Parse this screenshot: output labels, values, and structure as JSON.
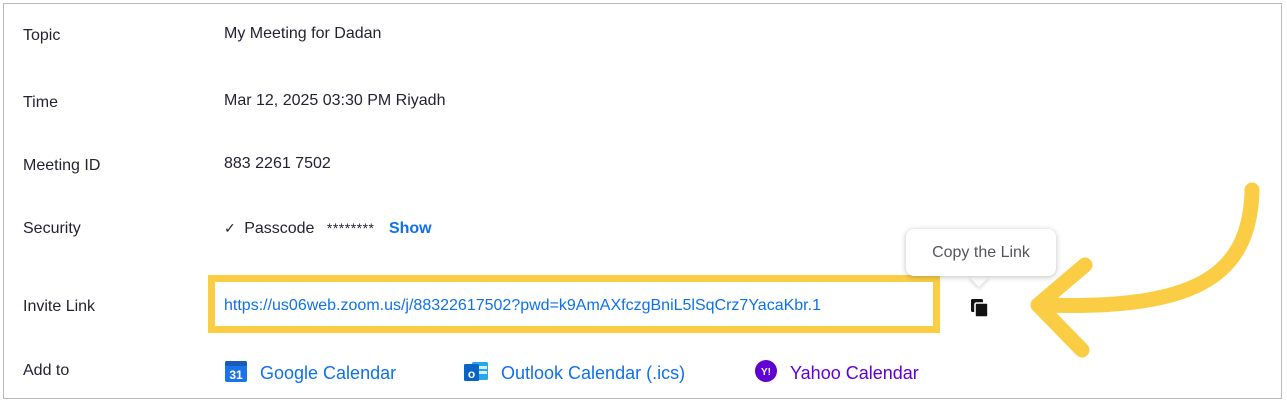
{
  "rows": {
    "topic": {
      "label": "Topic",
      "value": "My Meeting for Dadan"
    },
    "time": {
      "label": "Time",
      "value": "Mar 12, 2025 03:30 PM Riyadh"
    },
    "meeting_id": {
      "label": "Meeting ID",
      "value": "883 2261 7502"
    },
    "security": {
      "label": "Security",
      "passcode_label": "Passcode",
      "passcode_mask": "********",
      "show_label": "Show",
      "check": "✓"
    },
    "invite": {
      "label": "Invite Link",
      "url": "https://us06web.zoom.us/j/88322617502?pwd=k9AmAXfczgBniL5lSqCrz7YacaKbr.1"
    },
    "add_to": {
      "label": "Add to"
    }
  },
  "calendars": {
    "google": {
      "label": "Google Calendar",
      "icon": "google-calendar-icon",
      "badge": "31",
      "color": "#0e71eb"
    },
    "outlook": {
      "label": "Outlook Calendar (.ics)",
      "icon": "outlook-icon",
      "badge": "o",
      "color": "#0e71eb"
    },
    "yahoo": {
      "label": "Yahoo Calendar",
      "icon": "yahoo-icon",
      "badge": "Y!",
      "color": "#6001d2"
    }
  },
  "tooltip": {
    "text": "Copy the Link"
  },
  "colors": {
    "highlight": "#fbcd45",
    "link": "#0e71eb"
  }
}
